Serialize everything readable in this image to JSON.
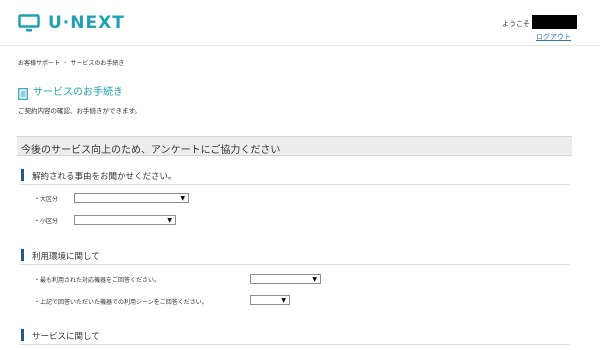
{
  "header": {
    "logo_text": "U·NEXT",
    "welcome": "ようこそ",
    "logout": "ログアウト"
  },
  "breadcrumb": {
    "items": [
      "お客様サポート",
      "サービスのお手続き"
    ]
  },
  "page": {
    "title": "サービスのお手続き",
    "subtitle": "ご契約内容の確認、お手続きができます。"
  },
  "survey": {
    "banner": "今後のサービス向上のため、アンケートにご協力ください",
    "sections": [
      {
        "title": "解約される事由をお聞かせください。",
        "fields": [
          {
            "label": "・大区分",
            "value": ""
          },
          {
            "label": "・小区分",
            "value": ""
          }
        ]
      },
      {
        "title": "利用環境に関して",
        "fields": [
          {
            "label": "・最も利用された対応機器をご回答ください。",
            "value": ""
          },
          {
            "label": "・上記で回答いただいた機器での利用シーンをご回答ください。",
            "value": ""
          }
        ]
      },
      {
        "title": "サービスに関して",
        "fields": []
      }
    ]
  },
  "colors": {
    "brand": "#1fa2b3",
    "section_bar": "#1f5f86",
    "link": "#2a7ab0",
    "banner_bg": "#ededed"
  },
  "icons": {
    "logo": "tv-icon",
    "page_title": "document-icon",
    "dropdown": "caret-down-icon"
  }
}
